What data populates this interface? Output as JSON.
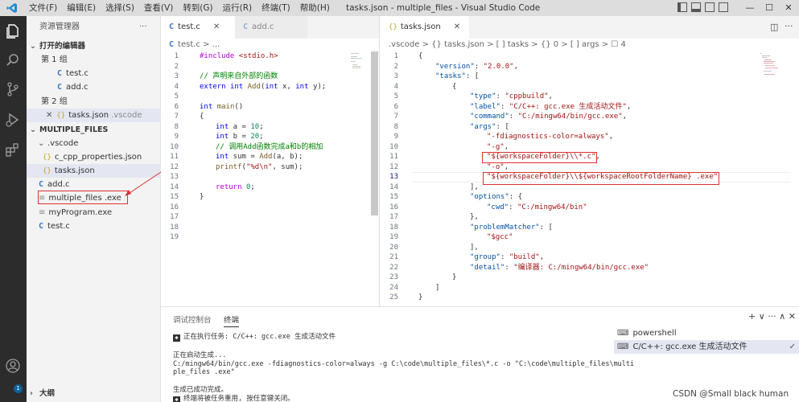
{
  "window": {
    "title": "tasks.json - multiple_files - Visual Studio Code",
    "menu": [
      "文件(F)",
      "编辑(E)",
      "选择(S)",
      "查看(V)",
      "转到(G)",
      "运行(R)",
      "终端(T)",
      "帮助(H)"
    ],
    "controls": {
      "minimize": "—",
      "maximize": "☐",
      "close": "✕"
    }
  },
  "sidebar": {
    "title": "资源管理器",
    "open_editors": "打开的编辑器",
    "group1": "第 1 组",
    "group1_files": [
      "test.c",
      "add.c"
    ],
    "group2": "第 2 组",
    "group2_file": "tasks.json",
    "group2_file_dir": ".vscode",
    "project": "MULTIPLE_FILES",
    "vscode_folder": ".vscode",
    "vscode_files": [
      "c_cpp_properties.json",
      "tasks.json"
    ],
    "root_files": [
      {
        "name": "add.c",
        "icon": "c"
      },
      {
        "name": "multiple_files .exe",
        "icon": "exe"
      },
      {
        "name": "myProgram.exe",
        "icon": "exe"
      },
      {
        "name": "test.c",
        "icon": "c"
      }
    ],
    "outline": "大纲",
    "account_badge": "1"
  },
  "editor_left": {
    "tabs": [
      {
        "label": "test.c",
        "close": "✕"
      },
      {
        "label": "add.c"
      }
    ],
    "breadcrumb": "test.c > ...",
    "line_numbers": [
      "1",
      "2",
      "3",
      "4",
      "5",
      "6",
      "7",
      "8",
      "9",
      "10",
      "11",
      "12",
      "13",
      "14",
      "15",
      "16",
      "17",
      "18",
      "19"
    ]
  },
  "editor_right": {
    "tabs": [
      {
        "label": "tasks.json",
        "close": "✕"
      }
    ],
    "breadcrumb": ".vscode > {} tasks.json > [ ] tasks > {} 0 > [ ] args > ☐ 4",
    "line_numbers": [
      "1",
      "2",
      "3",
      "4",
      "5",
      "6",
      "7",
      "8",
      "9",
      "10",
      "11",
      "12",
      "13",
      "14",
      "15",
      "16",
      "17",
      "18",
      "19",
      "20",
      "21",
      "22",
      "23",
      "24",
      "25"
    ]
  },
  "panel": {
    "tabs": [
      "调试控制台",
      "终端"
    ],
    "terminal_lines": [
      "正在执行任务: C/C++: gcc.exe 生成活动文件",
      "",
      "正在启动生成...",
      "C:/mingw64/bin/gcc.exe -fdiagnostics-color=always -g C:\\code\\multiple_files\\*.c -o \"C:\\code\\multiple_files\\multi",
      "ple_files .exe\"",
      "",
      "生成已成功完成。",
      "终端将被任务重用, 按任意键关闭。"
    ],
    "terminal_list": [
      "powershell",
      "C/C++: gcc.exe 生成活动文件"
    ],
    "controls": "+ ∨  ···  ∧  ✕"
  },
  "watermark": "CSDN @Small black human"
}
